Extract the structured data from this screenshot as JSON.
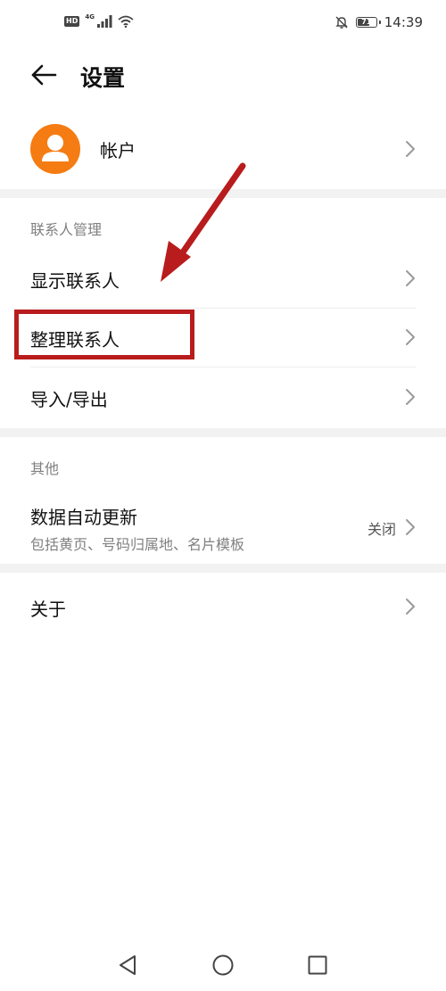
{
  "status_bar": {
    "hd": "HD",
    "network": "4G",
    "battery": "71",
    "battery_level": 0.71,
    "time": "14:39"
  },
  "header": {
    "title": "设置"
  },
  "account": {
    "label": "帐户"
  },
  "contacts_section": {
    "title": "联系人管理",
    "items": [
      {
        "label": "显示联系人"
      },
      {
        "label": "整理联系人"
      },
      {
        "label": "导入/导出"
      }
    ]
  },
  "other_section": {
    "title": "其他",
    "auto_update": {
      "label": "数据自动更新",
      "subtitle": "包括黄页、号码归属地、名片模板",
      "value": "关闭"
    }
  },
  "about": {
    "label": "关于"
  },
  "colors": {
    "avatar": "#f57c12",
    "annotation": "#b81c1c"
  }
}
